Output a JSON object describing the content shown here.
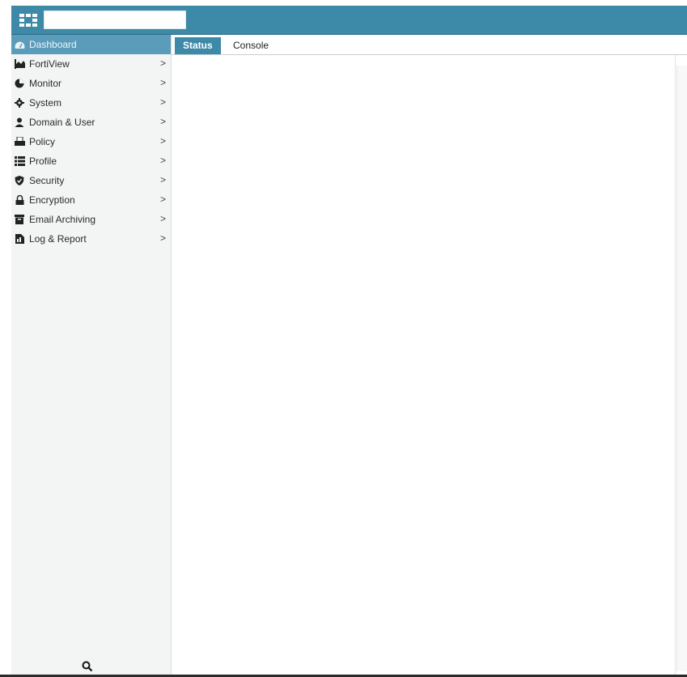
{
  "header": {
    "logo_icon": "fortinet-logo-icon",
    "title_value": "",
    "accent_color": "#3d89a8"
  },
  "sidebar": {
    "items": [
      {
        "label": "Dashboard",
        "icon": "dashboard-icon",
        "active": true,
        "has_submenu": false
      },
      {
        "label": "FortiView",
        "icon": "fortiview-icon",
        "active": false,
        "has_submenu": true
      },
      {
        "label": "Monitor",
        "icon": "monitor-icon",
        "active": false,
        "has_submenu": true
      },
      {
        "label": "System",
        "icon": "gear-icon",
        "active": false,
        "has_submenu": true
      },
      {
        "label": "Domain & User",
        "icon": "user-icon",
        "active": false,
        "has_submenu": true
      },
      {
        "label": "Policy",
        "icon": "policy-icon",
        "active": false,
        "has_submenu": true
      },
      {
        "label": "Profile",
        "icon": "profile-icon",
        "active": false,
        "has_submenu": true
      },
      {
        "label": "Security",
        "icon": "shield-icon",
        "active": false,
        "has_submenu": true
      },
      {
        "label": "Encryption",
        "icon": "lock-icon",
        "active": false,
        "has_submenu": true
      },
      {
        "label": "Email Archiving",
        "icon": "archive-icon",
        "active": false,
        "has_submenu": true
      },
      {
        "label": "Log & Report",
        "icon": "report-icon",
        "active": false,
        "has_submenu": true
      }
    ],
    "chevron": ">",
    "search_icon": "search-icon"
  },
  "main": {
    "tabs": [
      {
        "label": "Status",
        "active": true
      },
      {
        "label": "Console",
        "active": false
      }
    ]
  }
}
